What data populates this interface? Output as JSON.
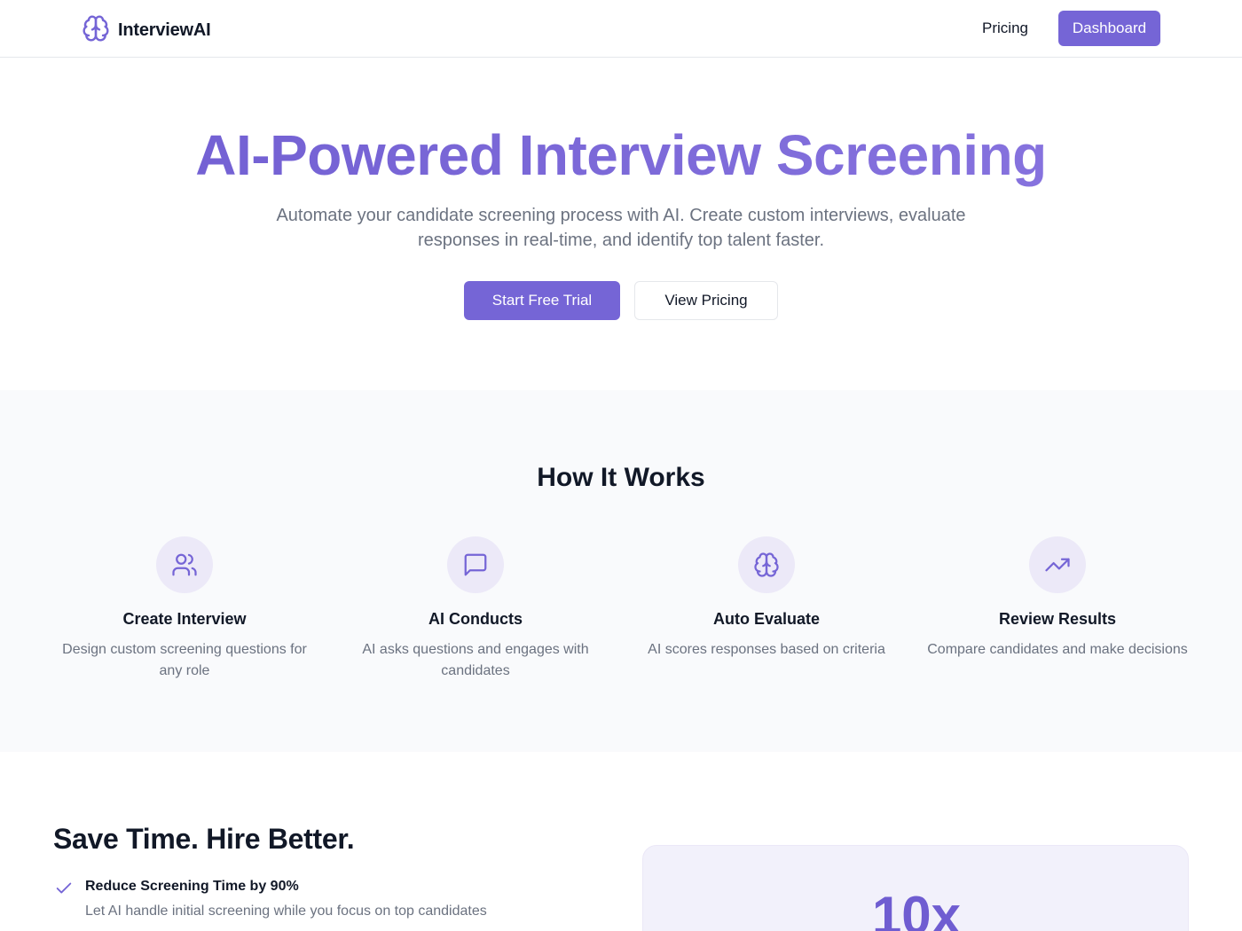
{
  "header": {
    "brand_name": "InterviewAI",
    "logo_icon": "brain-icon",
    "nav_pricing": "Pricing",
    "nav_dashboard": "Dashboard"
  },
  "hero": {
    "title": "AI-Powered Interview Screening",
    "subtitle": "Automate your candidate screening process with AI. Create custom interviews, evaluate responses in real-time, and identify top talent faster.",
    "cta_primary": "Start Free Trial",
    "cta_secondary": "View Pricing"
  },
  "how": {
    "title": "How It Works",
    "steps": [
      {
        "icon": "users-icon",
        "title": "Create Interview",
        "description": "Design custom screening questions for any role"
      },
      {
        "icon": "message-square-icon",
        "title": "AI Conducts",
        "description": "AI asks questions and engages with candidates"
      },
      {
        "icon": "brain-icon",
        "title": "Auto Evaluate",
        "description": "AI scores responses based on criteria"
      },
      {
        "icon": "trending-up-icon",
        "title": "Review Results",
        "description": "Compare candidates and make decisions"
      }
    ]
  },
  "benefits": {
    "title": "Save Time. Hire Better.",
    "items": [
      {
        "icon": "check-icon",
        "title": "Reduce Screening Time by 90%",
        "description": "Let AI handle initial screening while you focus on top candidates"
      }
    ],
    "stat": {
      "value": "10x"
    }
  },
  "colors": {
    "accent": "#7565d6",
    "accent_light": "#ece9f8",
    "section_bg": "#f9fafc",
    "text_muted": "#6b7280"
  }
}
